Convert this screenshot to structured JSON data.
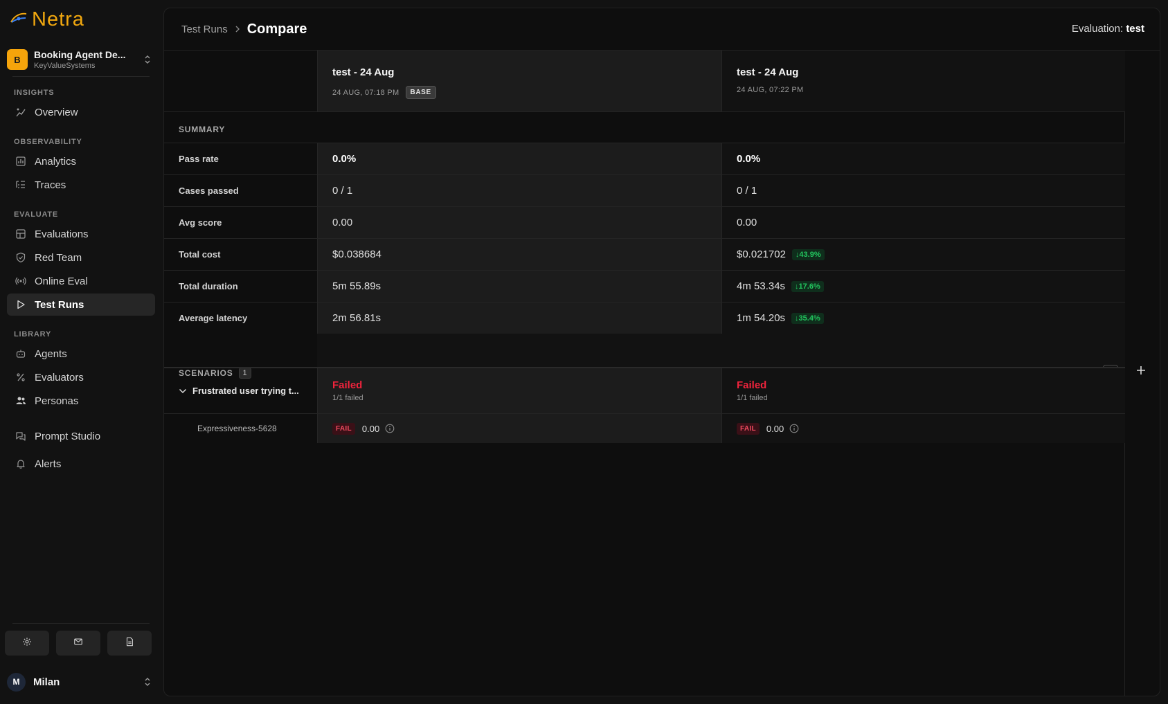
{
  "app": {
    "logo_text": "Netra"
  },
  "workspace": {
    "avatar": "B",
    "name": "Booking Agent De...",
    "org": "KeyValueSystems"
  },
  "sidebar": {
    "sections": [
      {
        "title": "INSIGHTS",
        "items": [
          {
            "label": "Overview",
            "icon": "sparkle-chart-icon"
          }
        ]
      },
      {
        "title": "OBSERVABILITY",
        "items": [
          {
            "label": "Analytics",
            "icon": "bar-chart-icon"
          },
          {
            "label": "Traces",
            "icon": "list-tree-icon"
          }
        ]
      },
      {
        "title": "EVALUATE",
        "items": [
          {
            "label": "Evaluations",
            "icon": "grid-icon"
          },
          {
            "label": "Red Team",
            "icon": "shield-icon"
          },
          {
            "label": "Online Eval",
            "icon": "radio-icon"
          },
          {
            "label": "Test Runs",
            "icon": "play-icon",
            "active": true
          }
        ]
      },
      {
        "title": "LIBRARY",
        "items": [
          {
            "label": "Agents",
            "icon": "bot-icon"
          },
          {
            "label": "Evaluators",
            "icon": "percent-icon"
          },
          {
            "label": "Personas",
            "icon": "users-icon"
          }
        ]
      }
    ],
    "extra_items": [
      {
        "label": "Prompt Studio",
        "icon": "chat-icon"
      },
      {
        "label": "Alerts",
        "icon": "bell-icon"
      }
    ]
  },
  "user": {
    "initial": "M",
    "name": "Milan"
  },
  "breadcrumb": {
    "parent": "Test Runs",
    "current": "Compare"
  },
  "evaluation": {
    "label": "Evaluation:",
    "value": "test"
  },
  "runs": [
    {
      "name": "test - 24 Aug",
      "time": "24 AUG, 07:18 PM",
      "badge": "BASE"
    },
    {
      "name": "test - 24 Aug",
      "time": "24 AUG, 07:22 PM"
    }
  ],
  "summary": {
    "title": "SUMMARY",
    "rows": [
      {
        "label": "Pass rate",
        "a": "0.0%",
        "b": "0.0%",
        "bold": true
      },
      {
        "label": "Cases passed",
        "a": "0 / 1",
        "b": "0 / 1"
      },
      {
        "label": "Avg score",
        "a": "0.00",
        "b": "0.00"
      },
      {
        "label": "Total cost",
        "a": "$0.038684",
        "b": "$0.021702",
        "delta": "↓43.9%"
      },
      {
        "label": "Total duration",
        "a": "5m 55.89s",
        "b": "4m 53.34s",
        "delta": "↓17.6%"
      },
      {
        "label": "Average latency",
        "a": "2m 56.81s",
        "b": "1m 54.20s",
        "delta": "↓35.4%"
      }
    ]
  },
  "scenarios": {
    "title": "SCENARIOS",
    "count": "1",
    "items": [
      {
        "label": "Frustrated user trying t...",
        "a": {
          "status": "Failed",
          "sub": "1/1 failed"
        },
        "b": {
          "status": "Failed",
          "sub": "1/1 failed"
        },
        "evaluators": [
          {
            "label": "Expressiveness-5628",
            "a": {
              "badge": "FAIL",
              "score": "0.00"
            },
            "b": {
              "badge": "FAIL",
              "score": "0.00"
            }
          }
        ]
      }
    ]
  },
  "colors": {
    "accent": "#f0a70f",
    "fail": "#ef233c",
    "delta_good": "#22c55e"
  }
}
